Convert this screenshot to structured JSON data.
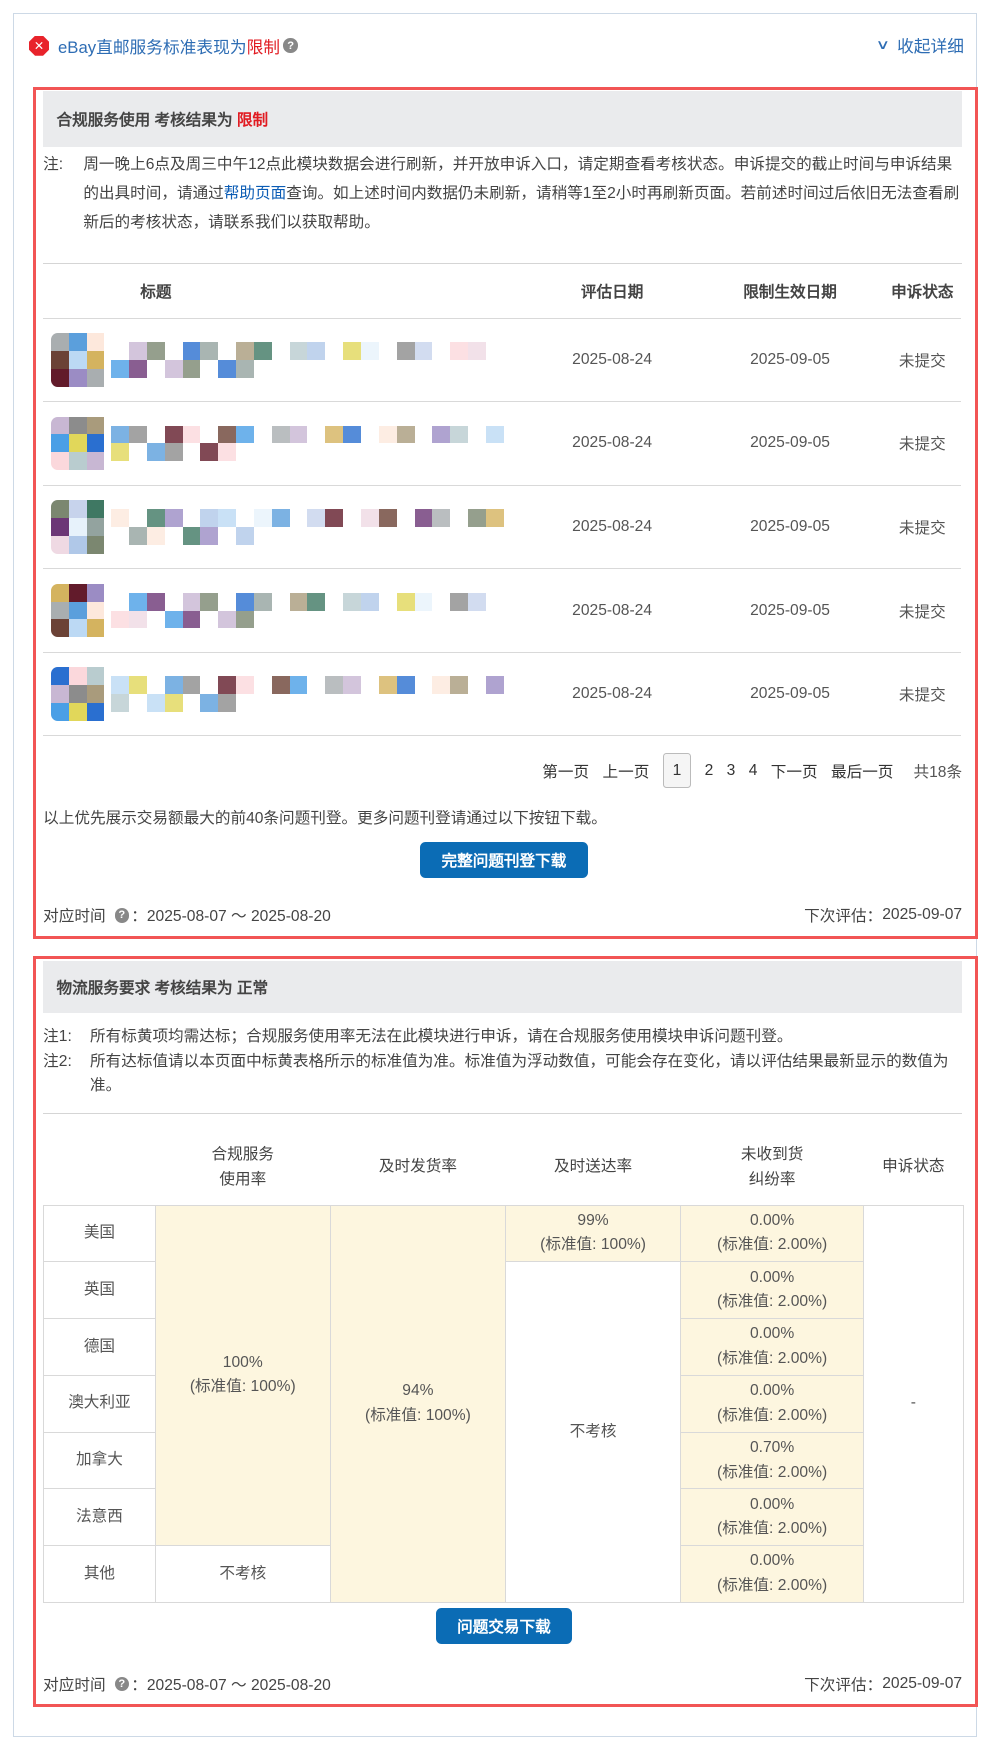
{
  "header": {
    "title": "eBay直邮服务标准表现为",
    "status": "限制",
    "collapse_label": "收起详细"
  },
  "compliance": {
    "title": "合规服务使用 考核结果为",
    "result": "限制",
    "note_label": "注:",
    "note_before": "周一晚上6点及周三中午12点此模块数据会进行刷新，并开放申诉入口，请定期查看考核状态。申诉提交的截止时间与申诉结果的出具时间，请通过",
    "note_link": "帮助页面",
    "note_after": "查询。如上述时间内数据仍未刷新，请稍等1至2小时再刷新页面。若前述时间过后依旧无法查看刷新后的考核状态，请联系我们以获取帮助。",
    "columns": [
      "标题",
      "评估日期",
      "限制生效日期",
      "申诉状态"
    ],
    "rows": [
      {
        "eval_date": "2025-08-24",
        "effective_date": "2025-09-05",
        "appeal": "未提交"
      },
      {
        "eval_date": "2025-08-24",
        "effective_date": "2025-09-05",
        "appeal": "未提交"
      },
      {
        "eval_date": "2025-08-24",
        "effective_date": "2025-09-05",
        "appeal": "未提交"
      },
      {
        "eval_date": "2025-08-24",
        "effective_date": "2025-09-05",
        "appeal": "未提交"
      },
      {
        "eval_date": "2025-08-24",
        "effective_date": "2025-09-05",
        "appeal": "未提交"
      }
    ],
    "pagination": {
      "first": "第一页",
      "prev": "上一页",
      "pages": [
        "1",
        "2",
        "3",
        "4"
      ],
      "current": "1",
      "next": "下一页",
      "last": "最后一页",
      "total": "共18条"
    },
    "info": "以上优先展示交易额最大的前40条问题刊登。更多问题刊登请通过以下按钮下载。",
    "download_label": "完整问题刊登下载",
    "period_label": "对应时间",
    "period": "2025-08-07 ～ 2025-08-20",
    "next_eval_label": "下次评估：",
    "next_eval": "2025-09-07"
  },
  "logistics": {
    "title": "物流服务要求 考核结果为",
    "result": "正常",
    "note1_label": "注1:",
    "note1": "所有标黄项均需达标；合规服务使用率无法在此模块进行申诉，请在合规服务使用模块申诉问题刊登。",
    "note2_label": "注2:",
    "note2": "所有达标值请以本页面中标黄表格所示的标准值为准。标准值为浮动数值，可能会存在变化，请以评估结果最新显示的数值为准。",
    "columns": {
      "compliance_1": "合规服务",
      "compliance_2": "使用率",
      "ship": "及时发货率",
      "delivery": "及时送达率",
      "inr_1": "未收到货",
      "inr_2": "纠纷率",
      "appeal": "申诉状态"
    },
    "compliance_value": "100%",
    "compliance_std": "(标准值: 100%)",
    "compliance_other": "不考核",
    "ship_value": "94%",
    "ship_std": "(标准值: 100%)",
    "delivery_us_value": "99%",
    "delivery_us_std": "(标准值: 100%)",
    "delivery_other": "不考核",
    "appeal_value": "-",
    "rows": [
      {
        "country": "美国",
        "inr": "0.00%",
        "inr_std": "(标准值: 2.00%)"
      },
      {
        "country": "英国",
        "inr": "0.00%",
        "inr_std": "(标准值: 2.00%)"
      },
      {
        "country": "德国",
        "inr": "0.00%",
        "inr_std": "(标准值: 2.00%)"
      },
      {
        "country": "澳大利亚",
        "inr": "0.00%",
        "inr_std": "(标准值: 2.00%)"
      },
      {
        "country": "加拿大",
        "inr": "0.70%",
        "inr_std": "(标准值: 2.00%)"
      },
      {
        "country": "法意西",
        "inr": "0.00%",
        "inr_std": "(标准值: 2.00%)"
      },
      {
        "country": "其他",
        "inr": "0.00%",
        "inr_std": "(标准值: 2.00%)"
      }
    ],
    "download_label": "问题交易下载",
    "period_label": "对应时间",
    "period": "2025-08-07 ～ 2025-08-20",
    "next_eval_label": "下次评估：",
    "next_eval": "2025-09-07"
  }
}
